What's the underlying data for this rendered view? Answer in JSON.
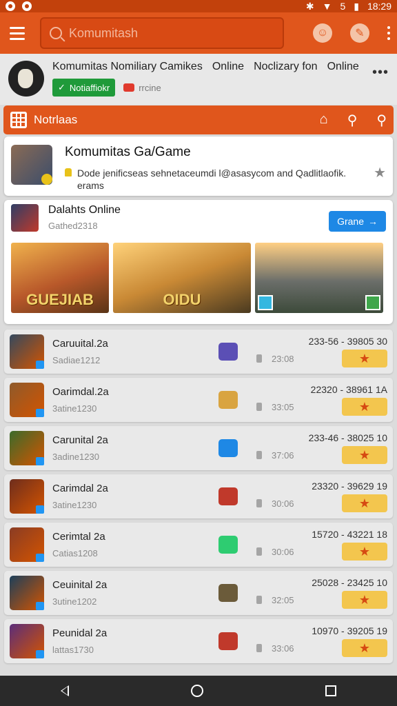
{
  "status": {
    "time": "18:29",
    "battery": "5"
  },
  "appbar": {
    "search_placeholder": "Komumitash"
  },
  "profile": {
    "title_a": "Komumitas Nomiliary Camikes",
    "title_b": "Online",
    "title_c": "Noclizary fon",
    "title_d": "Online",
    "badge_green": "Notiaffiokr",
    "badge_red": "rrcine"
  },
  "section": {
    "label": "Notrlaas"
  },
  "card1": {
    "title": "Komumitas Ga/Game",
    "desc": "Dode jenificseas sehnetaceumdi l@asasycom and Qadlitlaofik. erams"
  },
  "card2": {
    "title": "Dalahts Online",
    "sub": "Gathed2318",
    "button": "Grane",
    "banners": [
      "GUEJIAB",
      "OIDU",
      ""
    ]
  },
  "rows": [
    {
      "name": "Caruuital.2a",
      "sub": "Sadiae1212",
      "nums": "233-56 - 39805 30",
      "likes": "23:08",
      "icon": "#34495e",
      "mid": "#5b4fb5"
    },
    {
      "name": "Oarimdal.2a",
      "sub": "3atine1230",
      "nums": "22320 - 38961 1A",
      "likes": "33:05",
      "icon": "#8e5a2b",
      "mid": "#d9a441"
    },
    {
      "name": "Carunital 2a",
      "sub": "3adine1230",
      "nums": "233-46 - 38025 10",
      "likes": "37:06",
      "icon": "#3b6b2b",
      "mid": "#1e88e5"
    },
    {
      "name": "Carimdal 2a",
      "sub": "3atine1230",
      "nums": "23320 - 39629 19",
      "likes": "30:06",
      "icon": "#6e2d1d",
      "mid": "#c0392b"
    },
    {
      "name": "Cerimtal 2a",
      "sub": "Catias1208",
      "nums": "15720 - 43221 18",
      "likes": "30:06",
      "icon": "#8a3c24",
      "mid": "#2ecc71"
    },
    {
      "name": "Ceuinital 2a",
      "sub": "3utine1202",
      "nums": "25028 - 23425 10",
      "likes": "32:05",
      "icon": "#1c3f5a",
      "mid": "#6b5b3a"
    },
    {
      "name": "Peunidal 2a",
      "sub": "lattas1730",
      "nums": "10970 - 39205 19",
      "likes": "33:06",
      "icon": "#5b2d7a",
      "mid": "#c0392b"
    }
  ]
}
